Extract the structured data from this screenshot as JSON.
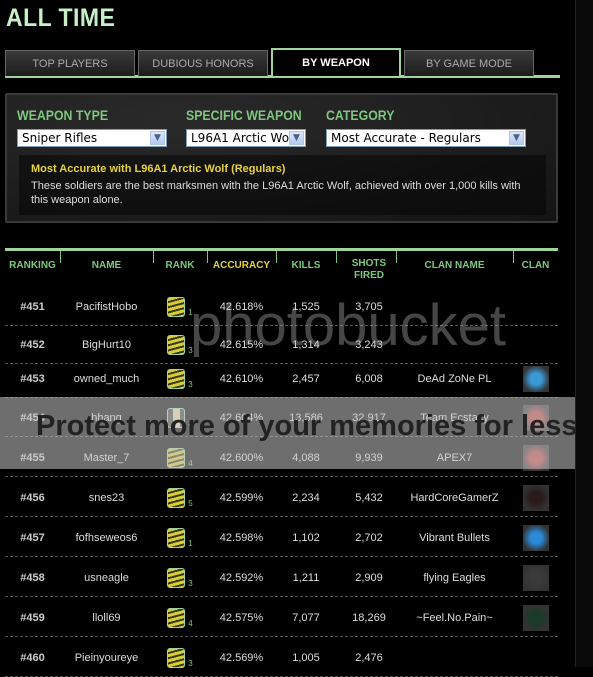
{
  "title": "ALL TIME",
  "tabs": [
    {
      "label": "TOP PLAYERS"
    },
    {
      "label": "DUBIOUS HONORS"
    },
    {
      "label": "BY WEAPON",
      "active": true
    },
    {
      "label": "BY GAME MODE"
    }
  ],
  "filters": {
    "weapon_type": {
      "label": "WEAPON TYPE",
      "value": "Sniper Rifles"
    },
    "specific_weapon": {
      "label": "SPECIFIC WEAPON",
      "value": "L96A1 Arctic Wo"
    },
    "category": {
      "label": "CATEGORY",
      "value": "Most Accurate - Regulars"
    }
  },
  "description": {
    "heading": "Most Accurate with L96A1 Arctic Wolf (Regulars)",
    "text": "These soldiers are the best marksmen with the L96A1 Arctic Wolf, achieved with over 1,000 kills with this weapon alone."
  },
  "columns": [
    "RANKING",
    "NAME",
    "RANK",
    "ACCURACY",
    "KILLS",
    "SHOTS FIRED",
    "CLAN NAME",
    "CLAN"
  ],
  "rows": [
    {
      "ranking": "#451",
      "name": "PacifistHobo",
      "rank_level": "1",
      "accuracy": "42.618%",
      "kills": "1,525",
      "shots": "3,705",
      "clan": "",
      "emblem": "none"
    },
    {
      "ranking": "#452",
      "name": "BigHurt10",
      "rank_level": "3",
      "accuracy": "42.615%",
      "kills": "1,314",
      "shots": "3,243",
      "clan": "",
      "emblem": "none"
    },
    {
      "ranking": "#453",
      "name": "owned_much",
      "rank_level": "3",
      "accuracy": "42.610%",
      "kills": "2,457",
      "shots": "6,008",
      "clan": "DeAd ZoNe PL",
      "emblem": "#3a9ad8"
    },
    {
      "ranking": "#454",
      "name": "hhang",
      "rank_level": "3",
      "accuracy": "42.604%",
      "kills": "13,586",
      "shots": "32,917",
      "clan": "Team Ecstacy",
      "emblem": "#c04040"
    },
    {
      "ranking": "#455",
      "name": "Master_7",
      "rank_level": "4",
      "accuracy": "42.600%",
      "kills": "4,088",
      "shots": "9,939",
      "clan": "APEX7",
      "emblem": "#c04040"
    },
    {
      "ranking": "#456",
      "name": "snes23",
      "rank_level": "5",
      "accuracy": "42.599%",
      "kills": "2,234",
      "shots": "5,432",
      "clan": "HardCoreGamerZ",
      "emblem": "#2a1a1a"
    },
    {
      "ranking": "#457",
      "name": "fofhseweos6",
      "rank_level": "1",
      "accuracy": "42.598%",
      "kills": "1,102",
      "shots": "2,702",
      "clan": "Vibrant Bullets",
      "emblem": "#2a8ad8"
    },
    {
      "ranking": "#458",
      "name": "usneagle",
      "rank_level": "3",
      "accuracy": "42.592%",
      "kills": "1,211",
      "shots": "2,909",
      "clan": "flying Eagles",
      "emblem": "#3a3a3a"
    },
    {
      "ranking": "#459",
      "name": "lloll69",
      "rank_level": "4",
      "accuracy": "42.575%",
      "kills": "7,077",
      "shots": "18,269",
      "clan": "~Feel.No.Pain~",
      "emblem": "#1a3a2a"
    },
    {
      "ranking": "#460",
      "name": "Pieinyoureye",
      "rank_level": "3",
      "accuracy": "42.569%",
      "kills": "1,005",
      "shots": "2,476",
      "clan": "",
      "emblem": "none"
    }
  ],
  "watermark": {
    "logo": "photobucket",
    "banner": "Protect more of your memories for less!"
  },
  "colors": {
    "accent_green": "#9fd49f",
    "header_yellow": "#e6d23a"
  }
}
